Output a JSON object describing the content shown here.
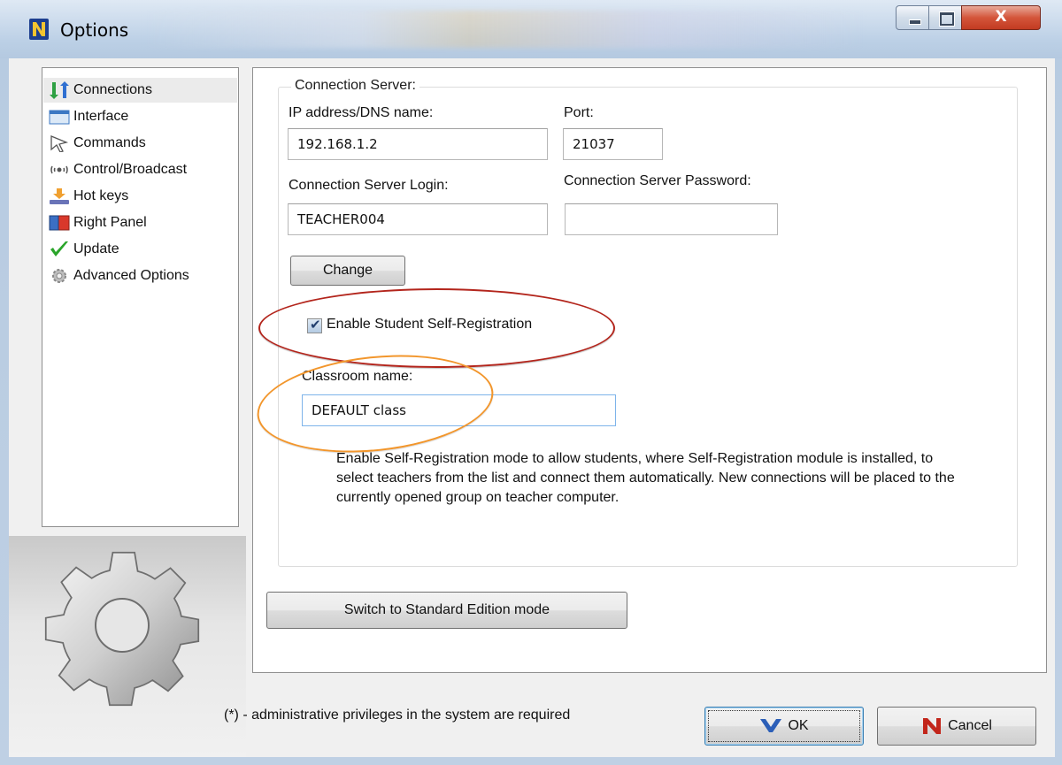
{
  "window": {
    "title": "Options",
    "close_glyph": "X"
  },
  "sidebar": {
    "items": [
      {
        "label": "Connections",
        "icon": "connections-icon",
        "selected": true
      },
      {
        "label": "Interface",
        "icon": "interface-icon"
      },
      {
        "label": "Commands",
        "icon": "cursor-icon"
      },
      {
        "label": "Control/Broadcast",
        "icon": "broadcast-icon"
      },
      {
        "label": "Hot keys",
        "icon": "hotkeys-icon"
      },
      {
        "label": "Right Panel",
        "icon": "panel-icon"
      },
      {
        "label": "Update",
        "icon": "checkmark-icon"
      },
      {
        "label": "Advanced Options",
        "icon": "gears-icon"
      }
    ]
  },
  "connection": {
    "group_title": "Connection Server:",
    "ip_label": "IP address/DNS name:",
    "ip_value": "192.168.1.2",
    "port_label": "Port:",
    "port_value": "21037",
    "login_label": "Connection Server Login:",
    "login_value": "TEACHER004",
    "password_label": "Connection Server Password:",
    "password_value": "",
    "change_button": "Change",
    "self_registration_label": "Enable Student Self-Registration",
    "self_registration_checked": true,
    "classroom_label": "Classroom name:",
    "classroom_value": "DEFAULT class",
    "description": "Enable Self-Registration mode to allow students, where Self-Registration module  is installed, to select teachers from the list and connect them automatically.  New connections will be placed to the currently opened group on teacher computer."
  },
  "switch_button": "Switch to Standard Edition mode",
  "footer": {
    "note": "(*) - administrative privileges in the system are required",
    "ok_button": "OK",
    "cancel_button": "Cancel"
  },
  "colors": {
    "annotation_red": "#b3251c",
    "annotation_orange": "#f2962c",
    "title_bar": "#bcd0e6"
  }
}
